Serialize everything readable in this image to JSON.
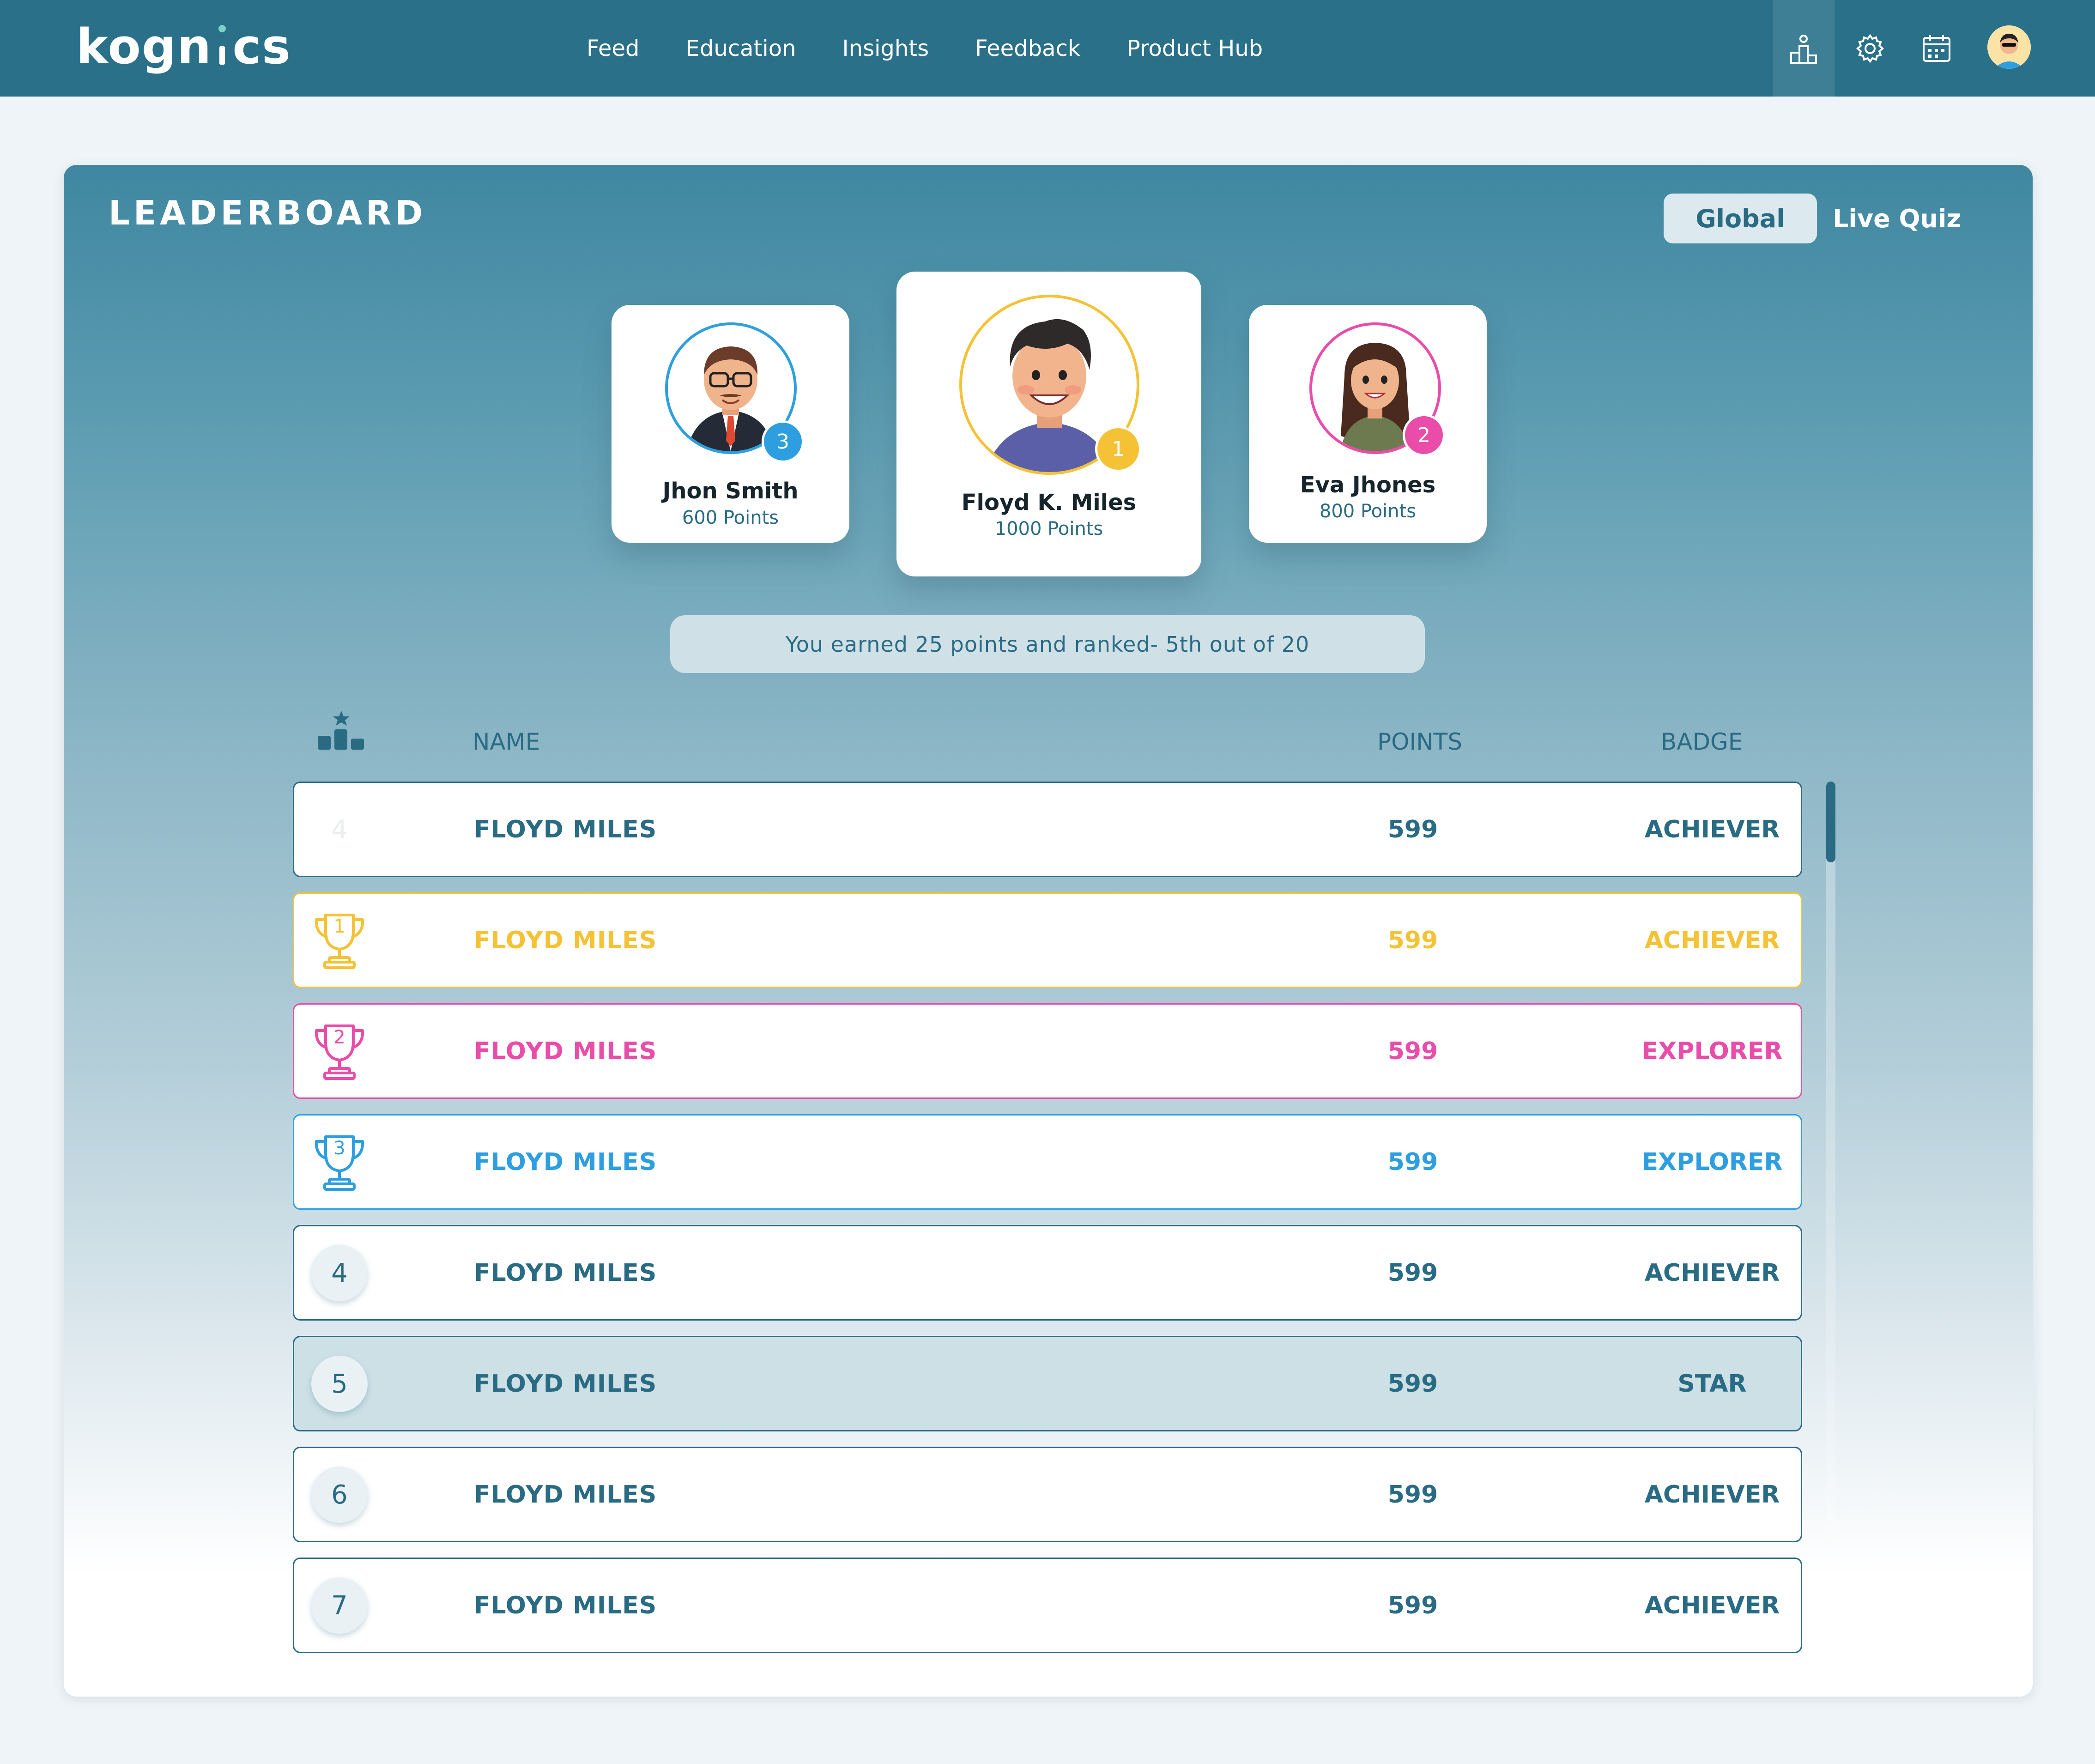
{
  "brand": {
    "logo_text_left": "kogn",
    "logo_text_right": "cs"
  },
  "nav": {
    "links": [
      "Feed",
      "Education",
      "Insights",
      "Feedback",
      "Product Hub"
    ],
    "icons": [
      "leaderboard-icon",
      "settings-gear-icon",
      "calendar-icon"
    ],
    "active_icon": "leaderboard-icon"
  },
  "leaderboard": {
    "title": "LEADERBOARD",
    "tabs": {
      "global": "Global",
      "live_quiz": "Live Quiz"
    },
    "active_tab": "Global"
  },
  "podium": [
    {
      "rank": "1",
      "name": "Floyd K. Miles",
      "points": "1000 Points",
      "color": "#f5c235"
    },
    {
      "rank": "2",
      "name": "Eva Jhones",
      "points": "800 Points",
      "color": "#e94ca9"
    },
    {
      "rank": "3",
      "name": "Jhon Smith",
      "points": "600 Points",
      "color": "#2d9fe0"
    }
  ],
  "summary": "You earned 25 points and ranked- 5th out of 20",
  "table": {
    "headers": {
      "rank_icon": "podium-icon",
      "name": "NAME",
      "points": "POINTS",
      "badge": "BADGE"
    },
    "rows": [
      {
        "rank": "4",
        "name": "FLOYD MILES",
        "points": "599",
        "badge": "ACHIEVER",
        "style": "faded"
      },
      {
        "rank": "1",
        "name": "FLOYD MILES",
        "points": "599",
        "badge": "ACHIEVER",
        "style": "gold"
      },
      {
        "rank": "2",
        "name": "FLOYD MILES",
        "points": "599",
        "badge": "EXPLORER",
        "style": "pink"
      },
      {
        "rank": "3",
        "name": "FLOYD MILES",
        "points": "599",
        "badge": "EXPLORER",
        "style": "blue"
      },
      {
        "rank": "4",
        "name": "FLOYD MILES",
        "points": "599",
        "badge": "ACHIEVER",
        "style": "default"
      },
      {
        "rank": "5",
        "name": "FLOYD MILES",
        "points": "599",
        "badge": "STAR",
        "style": "current"
      },
      {
        "rank": "6",
        "name": "FLOYD MILES",
        "points": "599",
        "badge": "ACHIEVER",
        "style": "default"
      },
      {
        "rank": "7",
        "name": "FLOYD MILES",
        "points": "599",
        "badge": "ACHIEVER",
        "style": "default"
      }
    ]
  },
  "colors": {
    "primary": "#2a6b84",
    "gold": "#f5c235",
    "pink": "#e94ca9",
    "blue": "#2d9fe0",
    "current_row_bg": "#cde0e6"
  }
}
